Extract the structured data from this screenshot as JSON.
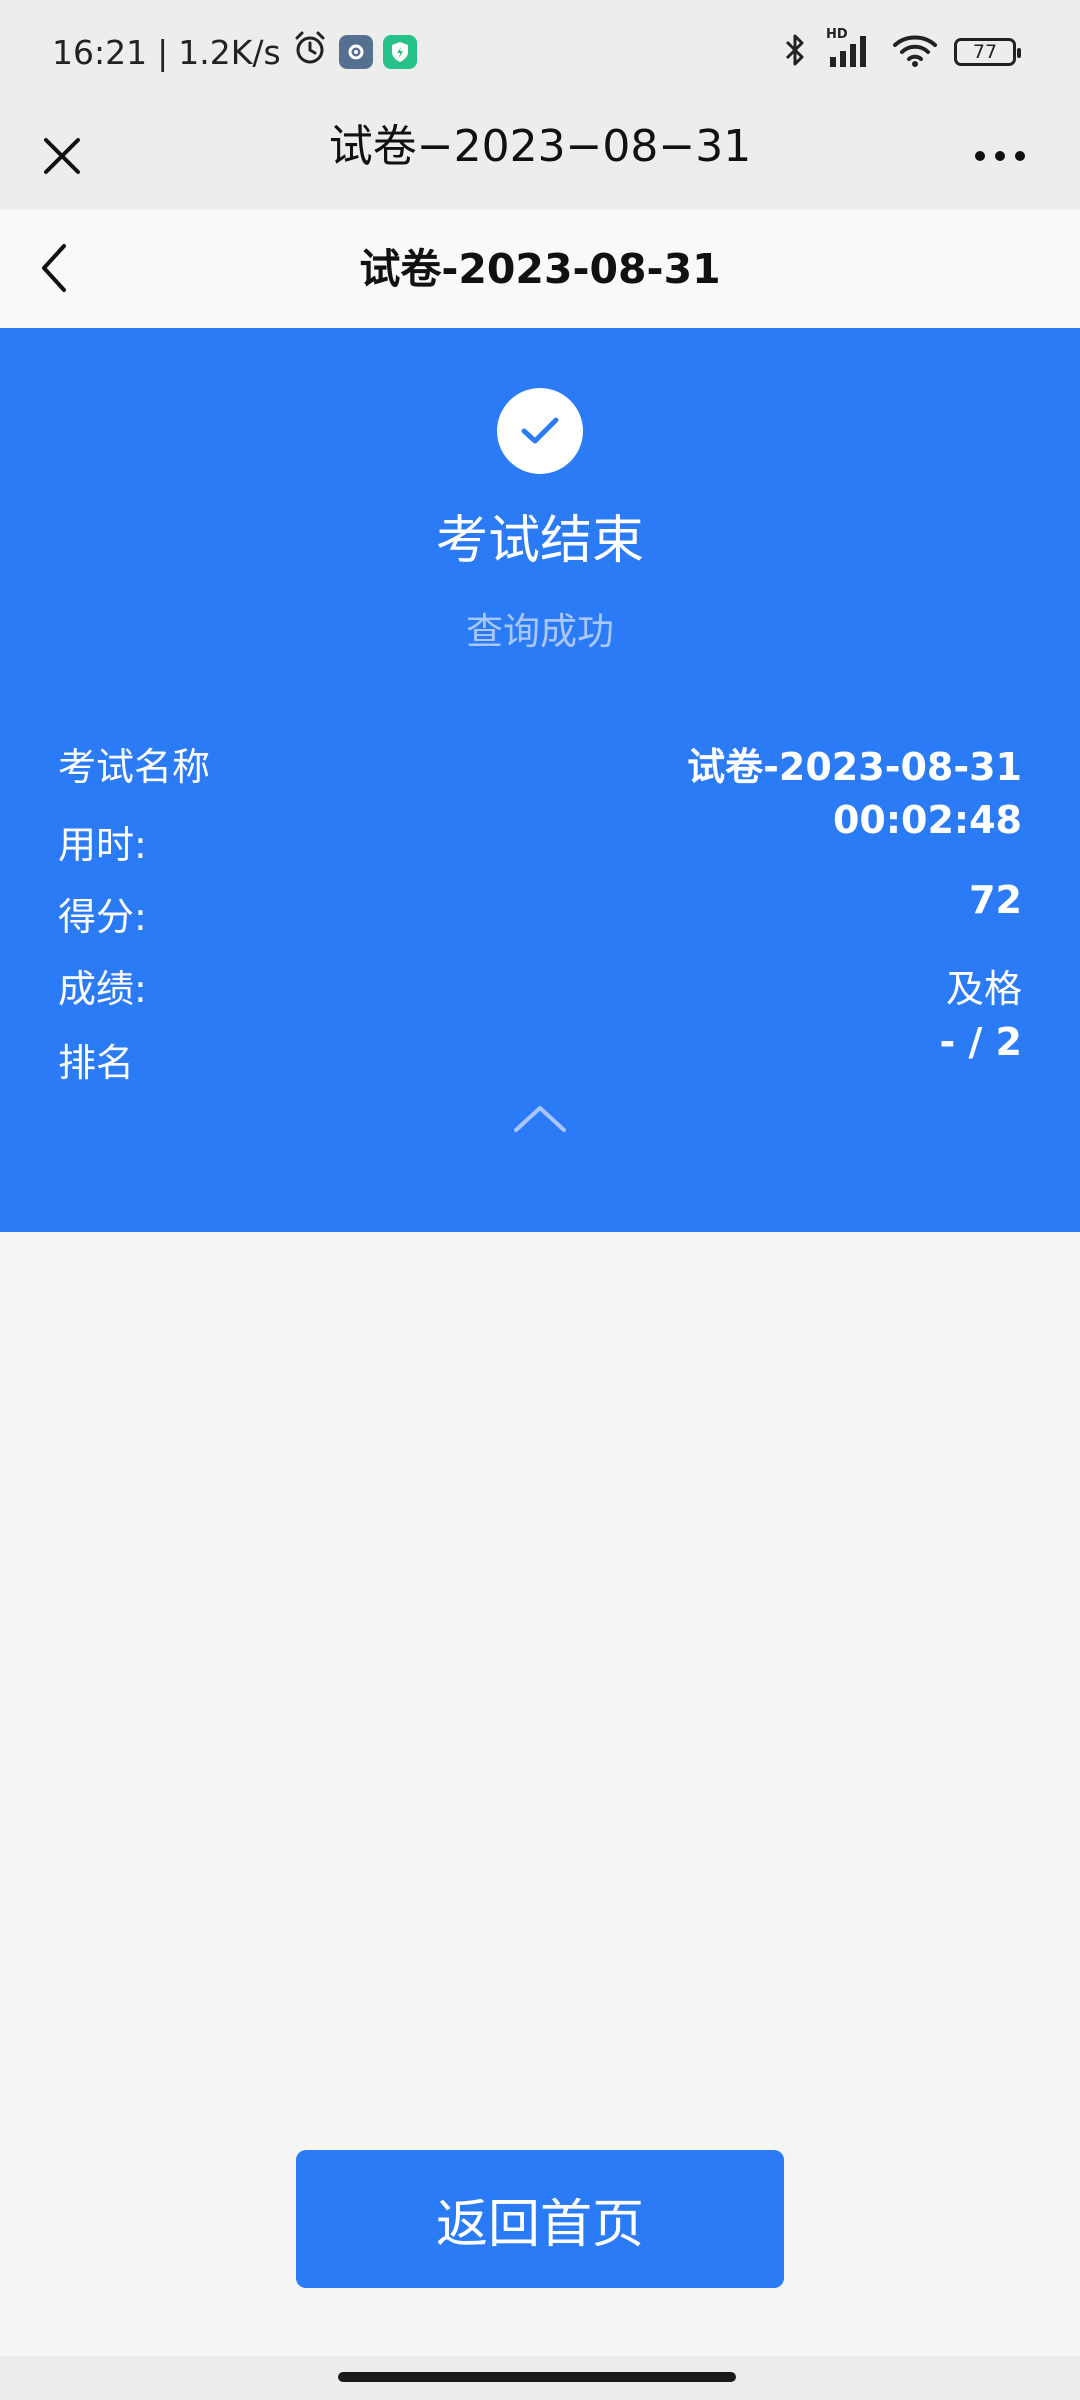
{
  "status_bar": {
    "time": "16:21",
    "separator": "|",
    "network_speed": "1.2K/s",
    "signal_label": "HD",
    "battery": "77",
    "icons": [
      "alarm-icon",
      "settings-app-icon",
      "shield-app-icon",
      "bluetooth-icon",
      "signal-icon",
      "wifi-icon",
      "battery-icon"
    ]
  },
  "wechat_bar": {
    "title": "试卷−2023−08−31",
    "close_icon": "close-icon",
    "more_icon": "more-icon"
  },
  "header": {
    "title": "试卷-2023-08-31",
    "back_icon": "chevron-left-icon"
  },
  "result": {
    "title": "考试结束",
    "subtitle": "查询成功",
    "rows": [
      {
        "label": "考试名称",
        "value": "试卷-2023-08-31"
      },
      {
        "label": "用时:",
        "value": "00:02:48"
      },
      {
        "label": "得分:",
        "value": "72"
      },
      {
        "label": "成绩:",
        "value": "及格"
      },
      {
        "label": "排名",
        "value": "- / 2"
      }
    ]
  },
  "actions": {
    "home_button": "返回首页"
  },
  "colors": {
    "primary_blue": "#2b7bf7",
    "page_bg": "#f5f5f5",
    "subtitle": "#a9c6ff"
  }
}
